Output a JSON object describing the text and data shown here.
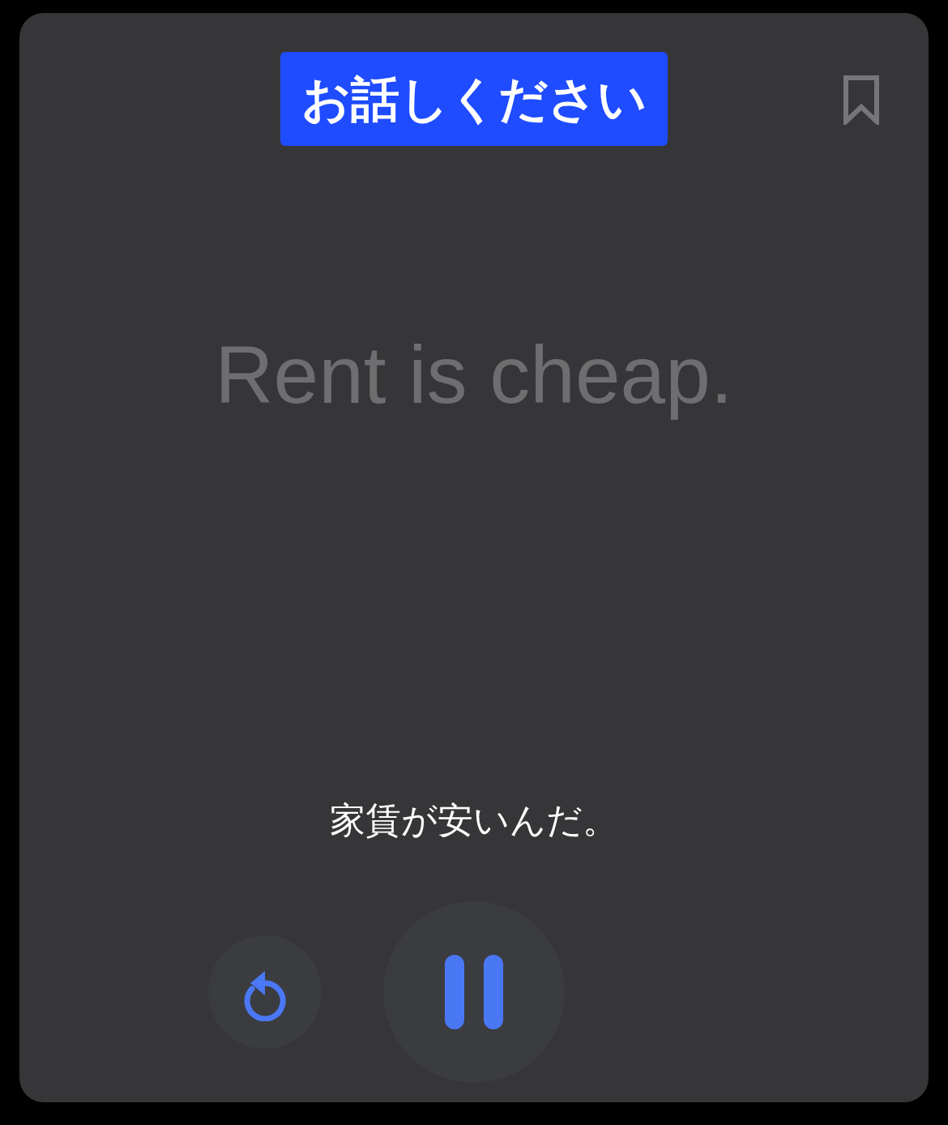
{
  "banner": {
    "text": "お話しください"
  },
  "bookmark": {
    "saved": false
  },
  "phrase": {
    "english": "Rent is cheap.",
    "japanese": "家賃が安いんだ。"
  },
  "controls": {
    "playing": true
  }
}
